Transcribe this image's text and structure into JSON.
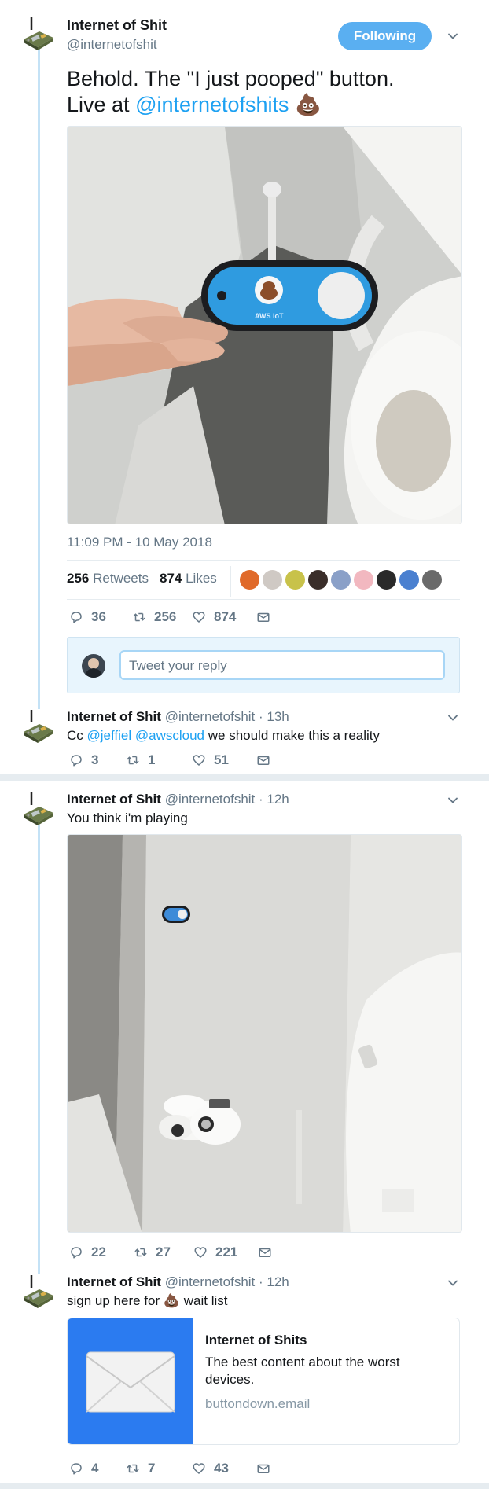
{
  "main_tweet": {
    "name": "Internet of Shit",
    "handle": "@internetofshit",
    "follow_label": "Following",
    "text_line1": "Behold. The \"I just pooped\" button.",
    "text_prefix": "Live at ",
    "mention": "@internetofshits",
    "emoji": "💩",
    "timestamp": "11:09 PM - 10 May 2018",
    "retweets_count": "256",
    "retweets_label": "Retweets",
    "likes_count": "874",
    "likes_label": "Likes",
    "reply_count": "36",
    "retweet_count": "256",
    "like_count": "874",
    "reply_placeholder": "Tweet your reply"
  },
  "reply1": {
    "name": "Internet of Shit",
    "handle": "@internetofshit",
    "time": "· 13h",
    "text_prefix": "Cc ",
    "mention1": "@jeffiel",
    "mention2": "@awscloud",
    "text_suffix": " we should make this a reality",
    "reply_count": "3",
    "retweet_count": "1",
    "like_count": "51"
  },
  "thread_tweet1": {
    "name": "Internet of Shit",
    "handle": "@internetofshit",
    "time": "· 12h",
    "text": "You think i'm playing",
    "reply_count": "22",
    "retweet_count": "27",
    "like_count": "221"
  },
  "thread_tweet2": {
    "name": "Internet of Shit",
    "handle": "@internetofshit",
    "time": "· 12h",
    "text_prefix": "sign up here for ",
    "emoji": "💩",
    "text_suffix": " wait list",
    "card_title": "Internet of Shits",
    "card_desc": "The best content about the worst devices.",
    "card_domain": "buttondown.email",
    "reply_count": "4",
    "retweet_count": "7",
    "like_count": "43"
  },
  "colors": {
    "accent": "#1da1f2",
    "thread_line": "#c4e2f6",
    "muted": "#657786",
    "card_blue": "#2b7bf0"
  }
}
